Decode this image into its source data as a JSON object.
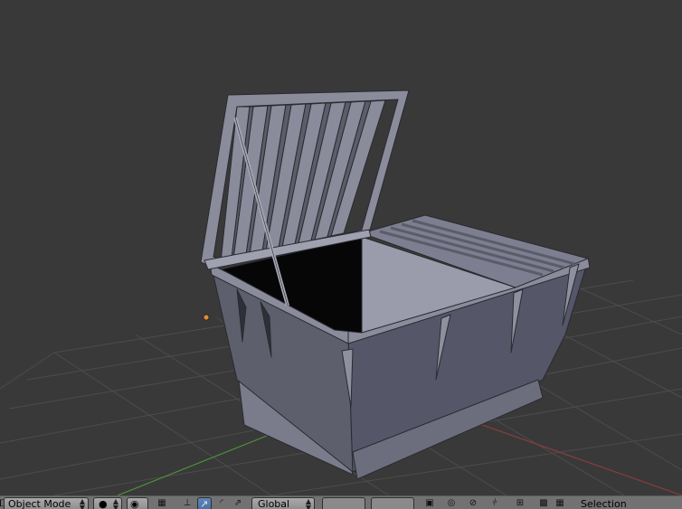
{
  "header": {
    "mode_label": "Object Mode",
    "orientation_label": "Global",
    "selection_label": "Selection"
  },
  "icons": {
    "editor": "editor-type-icon",
    "shading": "viewport-shading-icon",
    "pivot": "pivot-point-icon",
    "manipulator": "manipulator-toggle-icon",
    "translate": "translate-icon",
    "rotate": "rotate-icon",
    "scale": "scale-icon",
    "lock": "lock-camera-icon",
    "snap": "snap-icon",
    "proportional": "proportional-edit-icon",
    "render": "render-icon"
  },
  "colors": {
    "viewport_bg": "#393939",
    "grid": "#4b4b4b",
    "x_axis": "#8c3a3a",
    "y_axis": "#4a8c3a",
    "object": "#686a7a",
    "header_bg": "#727272",
    "active_button": "#5f86b8"
  }
}
